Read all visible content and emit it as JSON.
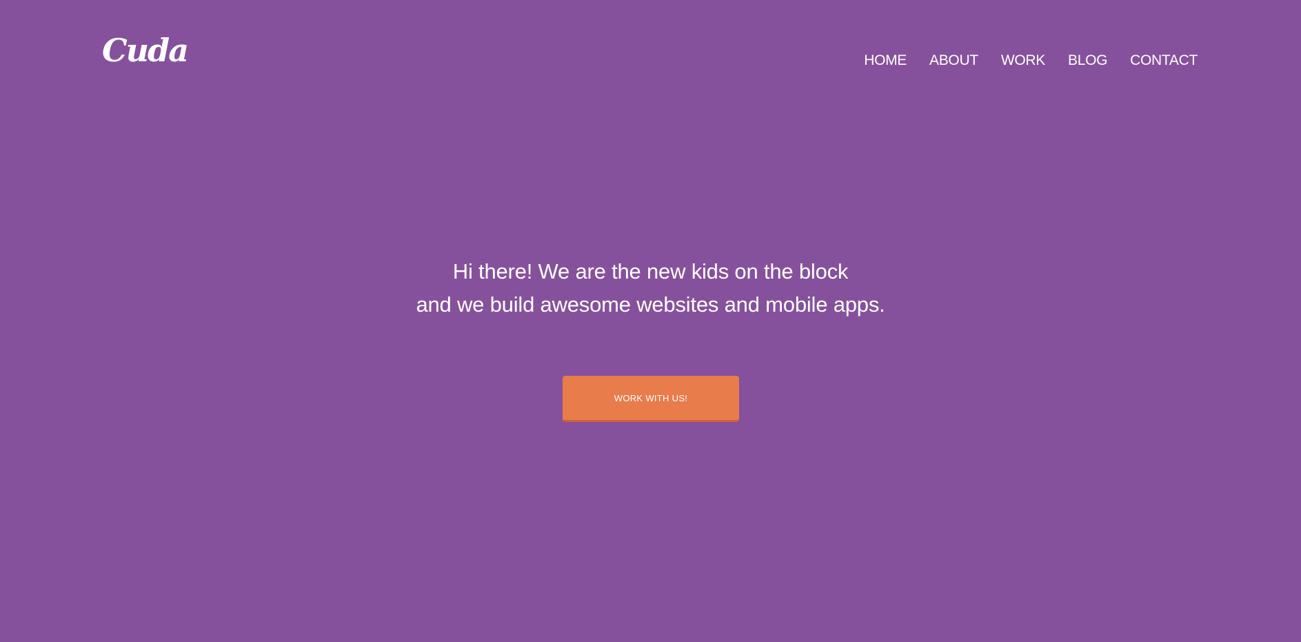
{
  "header": {
    "logo": "Cuda",
    "nav": [
      {
        "label": "HOME"
      },
      {
        "label": "ABOUT"
      },
      {
        "label": "WORK"
      },
      {
        "label": "BLOG"
      },
      {
        "label": "CONTACT"
      }
    ]
  },
  "hero": {
    "line1": "Hi there! We are the new kids on the block",
    "line2": "and we build awesome websites and mobile apps.",
    "cta_label": "WORK WITH US!"
  },
  "colors": {
    "background": "#86519c",
    "accent": "#e97c4b",
    "text": "#ffffff"
  }
}
